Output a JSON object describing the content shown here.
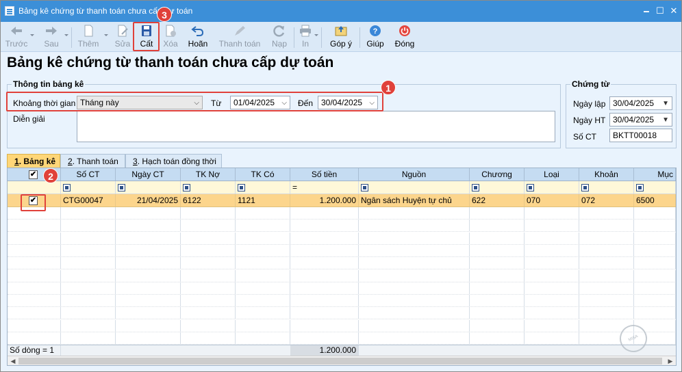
{
  "window": {
    "title": "Bảng kê chứng từ thanh toán chưa cấp dự toán",
    "minimize_glyph": "🗕",
    "maximize_glyph": "☐",
    "close_glyph": "✕"
  },
  "toolbar": {
    "items": [
      {
        "label": "Trước",
        "icon": "arrow-left-icon",
        "enabled": false
      },
      {
        "label": "Sau",
        "icon": "arrow-right-icon",
        "enabled": false
      },
      {
        "label": "Thêm",
        "icon": "add-document-icon",
        "enabled": false
      },
      {
        "label": "Sửa",
        "icon": "edit-document-icon",
        "enabled": false
      },
      {
        "label": "Cất",
        "icon": "save-icon",
        "enabled": true
      },
      {
        "label": "Xóa",
        "icon": "delete-document-icon",
        "enabled": false
      },
      {
        "label": "Hoãn",
        "icon": "undo-icon",
        "enabled": true
      },
      {
        "label": "Thanh toán",
        "icon": "pen-icon",
        "enabled": false
      },
      {
        "label": "Nạp",
        "icon": "refresh-icon",
        "enabled": false
      },
      {
        "label": "In",
        "icon": "printer-icon",
        "enabled": false
      },
      {
        "label": "Góp ý",
        "icon": "feedback-icon",
        "enabled": true
      },
      {
        "label": "Giúp",
        "icon": "help-icon",
        "enabled": true
      },
      {
        "label": "Đóng",
        "icon": "power-icon",
        "enabled": true
      }
    ]
  },
  "page_title": "Bảng kê chứng từ thanh toán chưa cấp dự toán",
  "info_group": {
    "title": "Thông tin bảng kê",
    "period_label": "Khoảng thời gian",
    "period_value": "Tháng này",
    "from_label": "Từ",
    "from_value": "01/04/2025",
    "to_label": "Đến",
    "to_value": "30/04/2025",
    "desc_label": "Diễn giải",
    "desc_value": ""
  },
  "voucher_group": {
    "title": "Chứng từ",
    "date_label": "Ngày lập",
    "date_value": "30/04/2025",
    "post_date_label": "Ngày HT",
    "post_date_value": "30/04/2025",
    "number_label": "Số CT",
    "number_value": "BKTT00018"
  },
  "badges": {
    "one": "1",
    "two": "2",
    "three": "3"
  },
  "tabs": [
    {
      "key": "1",
      "rest": ". Bảng kê",
      "active": true
    },
    {
      "key": "2",
      "rest": ". Thanh toán",
      "active": false
    },
    {
      "key": "3",
      "rest": ". Hạch toán đồng thời",
      "active": false
    }
  ],
  "grid": {
    "columns": [
      "Số CT",
      "Ngày CT",
      "TK Nợ",
      "TK Có",
      "Số tiền",
      "Nguồn",
      "Chương",
      "Loại",
      "Khoản",
      "Mục"
    ],
    "amount_filter_op": "=",
    "header_check": "✔",
    "rows": [
      {
        "checked": "✔",
        "so_ct": "CTG00047",
        "ngay_ct": "21/04/2025",
        "tk_no": "6122",
        "tk_co": "1121",
        "so_tien": "1.200.000",
        "nguon": "Ngân sách Huyện tự chủ",
        "chuong": "622",
        "loai": "070",
        "khoan": "072",
        "muc": "6500"
      }
    ],
    "footer_count": "Số dòng = 1",
    "footer_total": "1.200.000"
  },
  "watermark_text": "MISA"
}
